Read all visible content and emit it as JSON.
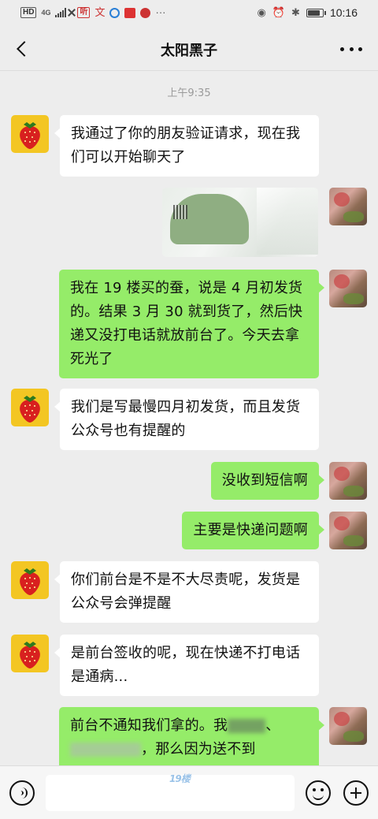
{
  "status_bar": {
    "hd_label": "HD",
    "network_label": "4G",
    "app_icons": [
      "signal-icon",
      "mute-icon",
      "ting-icon",
      "wen-icon",
      "browser-icon",
      "toutiao-icon",
      "mi-icon",
      "more-dots-icon"
    ],
    "ting_label": "听",
    "wen_label": "文",
    "dots_label": "···",
    "eye_label": "◉",
    "alarm_label": "⏰",
    "bluetooth_label": "✱",
    "time": "10:16"
  },
  "header": {
    "title": "太阳黑子"
  },
  "chat": {
    "timestamp": "上午9:35",
    "messages": [
      {
        "side": "in",
        "text": "我通过了你的朋友验证请求，现在我们可以开始聊天了"
      },
      {
        "side": "out",
        "type": "image"
      },
      {
        "side": "out",
        "text": "我在 19 楼买的蚕，说是 4 月初发货的。结果 3 月 30 就到货了，然后快递又没打电话就放前台了。今天去拿死光了"
      },
      {
        "side": "in",
        "text": "我们是写最慢四月初发货，而且发货公众号也有提醒的"
      },
      {
        "side": "out",
        "text": "没收到短信啊"
      },
      {
        "side": "out",
        "text": "主要是快递问题啊"
      },
      {
        "side": "in",
        "text": "你们前台是不是不大尽责呢，发货是公众号会弹提醒"
      },
      {
        "side": "in",
        "text": "是前台签收的呢，现在快递不打电话是通病..."
      },
      {
        "side": "out",
        "text_a": "前台不通知我们拿的。我",
        "text_b": "、",
        "text_c": "，那么因为送不到"
      }
    ]
  },
  "input_bar": {
    "placeholder": "",
    "watermark": "19楼"
  },
  "colors": {
    "background": "#ededed",
    "out_bubble": "#95ec69",
    "in_bubble": "#ffffff"
  }
}
